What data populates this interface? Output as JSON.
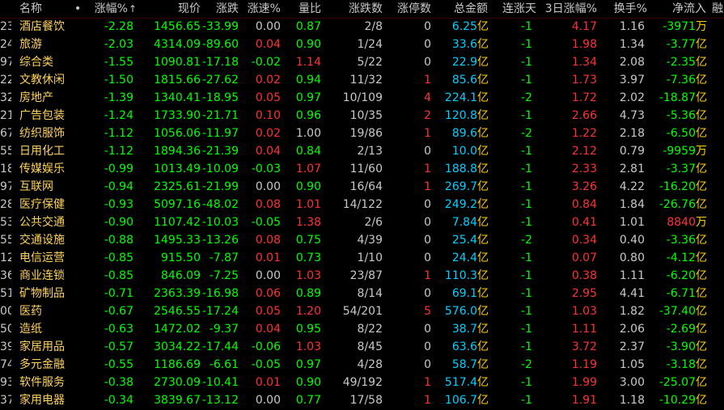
{
  "colors": {
    "up": "#ff3232",
    "down": "#00ff00",
    "neutral": "#c8c8c8",
    "name": "#ffd25a",
    "amount": "#00d0ff",
    "unit": "#ffd000",
    "code": "#c8c8c8",
    "header": "#c8c8c8"
  },
  "header": {
    "cols": [
      "名称",
      "•",
      "涨幅%",
      "现价",
      "涨跌",
      "涨速%",
      "量比",
      "涨跌数",
      "涨停数",
      "总金额",
      "连涨天",
      "3日涨幅%",
      "换手%",
      "净流入",
      "融"
    ],
    "sort_arrow": "↑"
  },
  "rows": [
    {
      "code": "23",
      "name": "酒店餐饮",
      "chg": "-2.28",
      "price": "1456.65",
      "diff": "-33.99",
      "speed": "0.00",
      "vr": "0.87",
      "adv": "2/8",
      "lim": "0",
      "amt": "6.25",
      "amt_unit": "亿",
      "streak": "-1",
      "d3": "4.17",
      "turn": "1.16",
      "flow": "-3971",
      "flow_unit": "万"
    },
    {
      "code": "24",
      "name": "旅游",
      "chg": "-2.03",
      "price": "4314.09",
      "diff": "-89.60",
      "speed": "0.04",
      "vr": "0.90",
      "adv": "1/24",
      "lim": "0",
      "amt": "33.6",
      "amt_unit": "亿",
      "streak": "-1",
      "d3": "1.98",
      "turn": "1.34",
      "flow": "-3.77",
      "flow_unit": "亿"
    },
    {
      "code": "97",
      "name": "综合类",
      "chg": "-1.55",
      "price": "1090.81",
      "diff": "-17.18",
      "speed": "-0.02",
      "vr": "1.14",
      "adv": "5/22",
      "lim": "0",
      "amt": "22.9",
      "amt_unit": "亿",
      "streak": "-1",
      "d3": "1.34",
      "turn": "2.08",
      "flow": "-2.35",
      "flow_unit": "亿"
    },
    {
      "code": "22",
      "name": "文教休闲",
      "chg": "-1.50",
      "price": "1815.66",
      "diff": "-27.62",
      "speed": "0.02",
      "vr": "0.94",
      "adv": "11/32",
      "lim": "1",
      "amt": "85.6",
      "amt_unit": "亿",
      "streak": "-1",
      "d3": "1.73",
      "turn": "3.97",
      "flow": "-7.36",
      "flow_unit": "亿"
    },
    {
      "code": "32",
      "name": "房地产",
      "chg": "-1.39",
      "price": "1340.41",
      "diff": "-18.95",
      "speed": "0.05",
      "vr": "0.97",
      "adv": "10/109",
      "lim": "4",
      "amt": "224.1",
      "amt_unit": "亿",
      "streak": "-2",
      "d3": "1.72",
      "turn": "2.02",
      "flow": "-18.87",
      "flow_unit": "亿"
    },
    {
      "code": "21",
      "name": "广告包装",
      "chg": "-1.24",
      "price": "1733.90",
      "diff": "-21.71",
      "speed": "0.10",
      "vr": "0.96",
      "adv": "10/35",
      "lim": "2",
      "amt": "120.8",
      "amt_unit": "亿",
      "streak": "-1",
      "d3": "2.66",
      "turn": "4.73",
      "flow": "-5.36",
      "flow_unit": "亿"
    },
    {
      "code": "67",
      "name": "纺织服饰",
      "chg": "-1.12",
      "price": "1056.06",
      "diff": "-11.97",
      "speed": "0.02",
      "vr": "1.00",
      "adv": "19/86",
      "lim": "1",
      "amt": "89.6",
      "amt_unit": "亿",
      "streak": "-2",
      "d3": "1.22",
      "turn": "2.18",
      "flow": "-6.50",
      "flow_unit": "亿"
    },
    {
      "code": "55",
      "name": "日用化工",
      "chg": "-1.12",
      "price": "1894.36",
      "diff": "-21.39",
      "speed": "0.04",
      "vr": "0.84",
      "adv": "2/13",
      "lim": "0",
      "amt": "10.0",
      "amt_unit": "亿",
      "streak": "-1",
      "d3": "2.12",
      "turn": "0.79",
      "flow": "-9959",
      "flow_unit": "万"
    },
    {
      "code": "18",
      "name": "传媒娱乐",
      "chg": "-0.99",
      "price": "1013.49",
      "diff": "-10.09",
      "speed": "-0.03",
      "vr": "1.07",
      "adv": "11/60",
      "lim": "1",
      "amt": "188.8",
      "amt_unit": "亿",
      "streak": "-1",
      "d3": "2.33",
      "turn": "2.81",
      "flow": "-3.37",
      "flow_unit": "亿"
    },
    {
      "code": "97",
      "name": "互联网",
      "chg": "-0.94",
      "price": "2325.61",
      "diff": "-21.99",
      "speed": "0.00",
      "vr": "0.90",
      "adv": "16/64",
      "lim": "1",
      "amt": "269.7",
      "amt_unit": "亿",
      "streak": "-1",
      "d3": "3.26",
      "turn": "4.22",
      "flow": "-16.20",
      "flow_unit": "亿"
    },
    {
      "code": "28",
      "name": "医疗保健",
      "chg": "-0.93",
      "price": "5097.16",
      "diff": "-48.02",
      "speed": "0.08",
      "vr": "1.01",
      "adv": "14/122",
      "lim": "0",
      "amt": "249.2",
      "amt_unit": "亿",
      "streak": "-1",
      "d3": "0.84",
      "turn": "1.84",
      "flow": "-26.76",
      "flow_unit": "亿"
    },
    {
      "code": "53",
      "name": "公共交通",
      "chg": "-0.90",
      "price": "1107.42",
      "diff": "-10.03",
      "speed": "-0.05",
      "vr": "1.38",
      "adv": "2/6",
      "lim": "0",
      "amt": "7.84",
      "amt_unit": "亿",
      "streak": "-1",
      "d3": "0.41",
      "turn": "1.01",
      "flow": "8840",
      "flow_unit": "万"
    },
    {
      "code": "55",
      "name": "交通设施",
      "chg": "-0.88",
      "price": "1495.33",
      "diff": "-13.26",
      "speed": "0.08",
      "vr": "0.75",
      "adv": "4/39",
      "lim": "0",
      "amt": "25.4",
      "amt_unit": "亿",
      "streak": "-2",
      "d3": "0.34",
      "turn": "0.40",
      "flow": "-3.36",
      "flow_unit": "亿"
    },
    {
      "code": "12",
      "name": "电信运营",
      "chg": "-0.85",
      "price": "915.50",
      "diff": "-7.87",
      "speed": "0.01",
      "vr": "0.73",
      "adv": "1/10",
      "lim": "0",
      "amt": "24.4",
      "amt_unit": "亿",
      "streak": "-1",
      "d3": "0.07",
      "turn": "0.80",
      "flow": "-4.12",
      "flow_unit": "亿"
    },
    {
      "code": "36",
      "name": "商业连锁",
      "chg": "-0.85",
      "price": "846.09",
      "diff": "-7.25",
      "speed": "0.00",
      "vr": "1.03",
      "adv": "23/87",
      "lim": "1",
      "amt": "110.3",
      "amt_unit": "亿",
      "streak": "-1",
      "d3": "0.38",
      "turn": "1.11",
      "flow": "-6.20",
      "flow_unit": "亿"
    },
    {
      "code": "51",
      "name": "矿物制品",
      "chg": "-0.71",
      "price": "2363.39",
      "diff": "-16.98",
      "speed": "0.06",
      "vr": "0.89",
      "adv": "8/14",
      "lim": "0",
      "amt": "69.1",
      "amt_unit": "亿",
      "streak": "-1",
      "d3": "2.95",
      "turn": "4.41",
      "flow": "-6.71",
      "flow_unit": "亿"
    },
    {
      "code": "00",
      "name": "医药",
      "chg": "-0.67",
      "price": "2546.55",
      "diff": "-17.24",
      "speed": "0.05",
      "vr": "1.20",
      "adv": "54/201",
      "lim": "5",
      "amt": "576.0",
      "amt_unit": "亿",
      "streak": "-1",
      "d3": "1.03",
      "turn": "1.82",
      "flow": "-37.40",
      "flow_unit": "亿"
    },
    {
      "code": "50",
      "name": "造纸",
      "chg": "-0.63",
      "price": "1472.02",
      "diff": "-9.37",
      "speed": "0.04",
      "vr": "0.95",
      "adv": "8/22",
      "lim": "0",
      "amt": "38.7",
      "amt_unit": "亿",
      "streak": "-1",
      "d3": "1.11",
      "turn": "2.06",
      "flow": "-2.69",
      "flow_unit": "亿"
    },
    {
      "code": "39",
      "name": "家居用品",
      "chg": "-0.57",
      "price": "3034.22",
      "diff": "-17.44",
      "speed": "-0.06",
      "vr": "1.03",
      "adv": "8/45",
      "lim": "0",
      "amt": "63.6",
      "amt_unit": "亿",
      "streak": "-1",
      "d3": "3.72",
      "turn": "2.37",
      "flow": "-3.90",
      "flow_unit": "亿"
    },
    {
      "code": "74",
      "name": "多元金融",
      "chg": "-0.55",
      "price": "1186.69",
      "diff": "-6.61",
      "speed": "-0.05",
      "vr": "0.97",
      "adv": "4/28",
      "lim": "0",
      "amt": "58.7",
      "amt_unit": "亿",
      "streak": "-2",
      "d3": "1.19",
      "turn": "1.05",
      "flow": "-3.18",
      "flow_unit": "亿"
    },
    {
      "code": "93",
      "name": "软件服务",
      "chg": "-0.38",
      "price": "2730.09",
      "diff": "-10.41",
      "speed": "0.01",
      "vr": "0.90",
      "adv": "49/192",
      "lim": "1",
      "amt": "517.4",
      "amt_unit": "亿",
      "streak": "-1",
      "d3": "1.99",
      "turn": "3.00",
      "flow": "-25.07",
      "flow_unit": "亿"
    },
    {
      "code": "37",
      "name": "家用电器",
      "chg": "-0.34",
      "price": "3839.67",
      "diff": "-13.12",
      "speed": "0.00",
      "vr": "0.77",
      "adv": "17/58",
      "lim": "1",
      "amt": "106.7",
      "amt_unit": "亿",
      "streak": "-1",
      "d3": "1.91",
      "turn": "1.18",
      "flow": "-10.29",
      "flow_unit": "亿"
    }
  ]
}
